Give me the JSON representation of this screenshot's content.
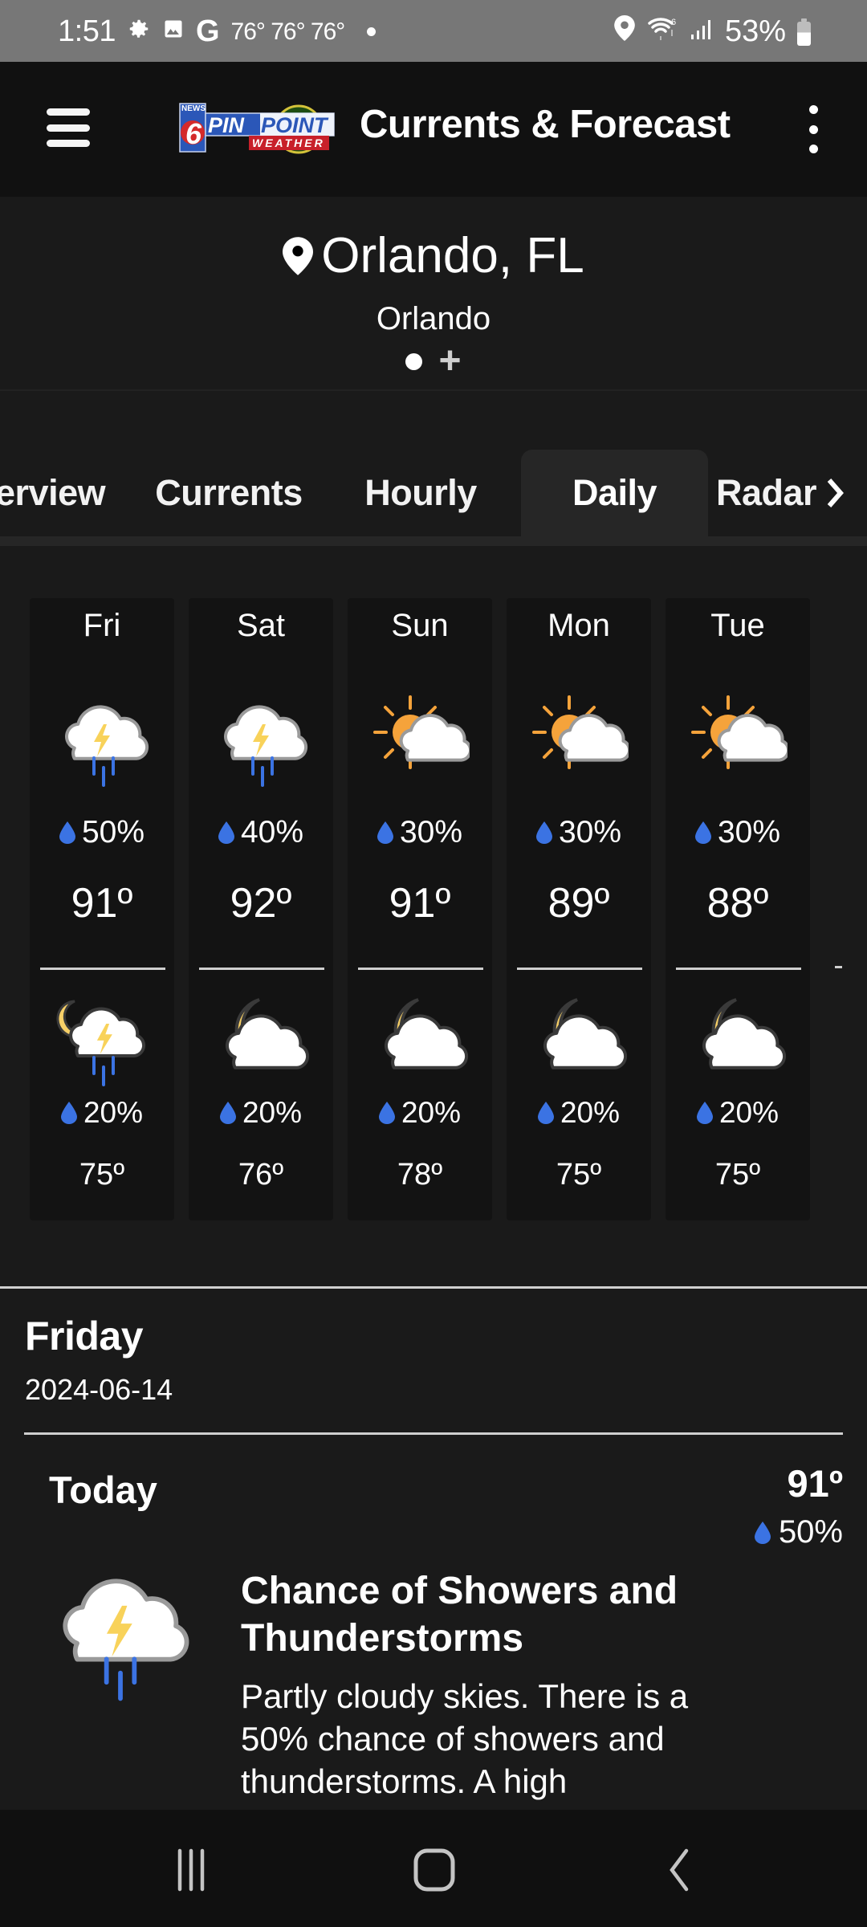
{
  "status_bar": {
    "time": "1:51",
    "notif_temps": "76° 76° 76°",
    "battery": "53%",
    "icons_left": [
      "settings-icon",
      "gallery-icon",
      "google-icon"
    ],
    "icons_right": [
      "location-icon",
      "wifi-icon",
      "signal-icon",
      "battery-icon"
    ]
  },
  "app_bar": {
    "title": "Currents & Forecast",
    "logo_top": "NEWS",
    "logo_number": "6",
    "logo_pin": "PIN",
    "logo_point": "POINT",
    "logo_weather": "WEATHER"
  },
  "location": {
    "name": "Orlando, FL",
    "subtitle": "Orlando",
    "add_label": "+"
  },
  "tabs": [
    {
      "label": "Overview",
      "visible_label": "erview",
      "active": false
    },
    {
      "label": "Currents",
      "active": false
    },
    {
      "label": "Hourly",
      "active": false
    },
    {
      "label": "Daily",
      "active": true
    },
    {
      "label": "Radar",
      "active": false
    }
  ],
  "daily": [
    {
      "day": "Fri",
      "day_icon": "thunderstorm",
      "day_precip": "50%",
      "high": "91º",
      "night_icon": "night-thunderstorm",
      "night_precip": "20%",
      "low": "75º"
    },
    {
      "day": "Sat",
      "day_icon": "thunderstorm",
      "day_precip": "40%",
      "high": "92º",
      "night_icon": "partly-cloudy-night",
      "night_precip": "20%",
      "low": "76º"
    },
    {
      "day": "Sun",
      "day_icon": "partly-sunny",
      "day_precip": "30%",
      "high": "91º",
      "night_icon": "partly-cloudy-night",
      "night_precip": "20%",
      "low": "78º"
    },
    {
      "day": "Mon",
      "day_icon": "partly-sunny",
      "day_precip": "30%",
      "high": "89º",
      "night_icon": "partly-cloudy-night",
      "night_precip": "20%",
      "low": "75º"
    },
    {
      "day": "Tue",
      "day_icon": "partly-sunny",
      "day_precip": "30%",
      "high": "88º",
      "night_icon": "partly-cloudy-night",
      "night_precip": "20%",
      "low": "75º"
    }
  ],
  "detail": {
    "day": "Friday",
    "date": "2024-06-14",
    "period": "Today",
    "high": "91º",
    "precip": "50%",
    "condition": "Chance of Showers and Thunderstorms",
    "description": "Partly cloudy skies. There is a 50% chance of showers and thunderstorms. A high"
  },
  "colors": {
    "accent_blue": "#3b73e3",
    "sun_orange": "#f5a33b",
    "moon_yellow": "#f7d067",
    "bolt_yellow": "#f8d25a"
  }
}
